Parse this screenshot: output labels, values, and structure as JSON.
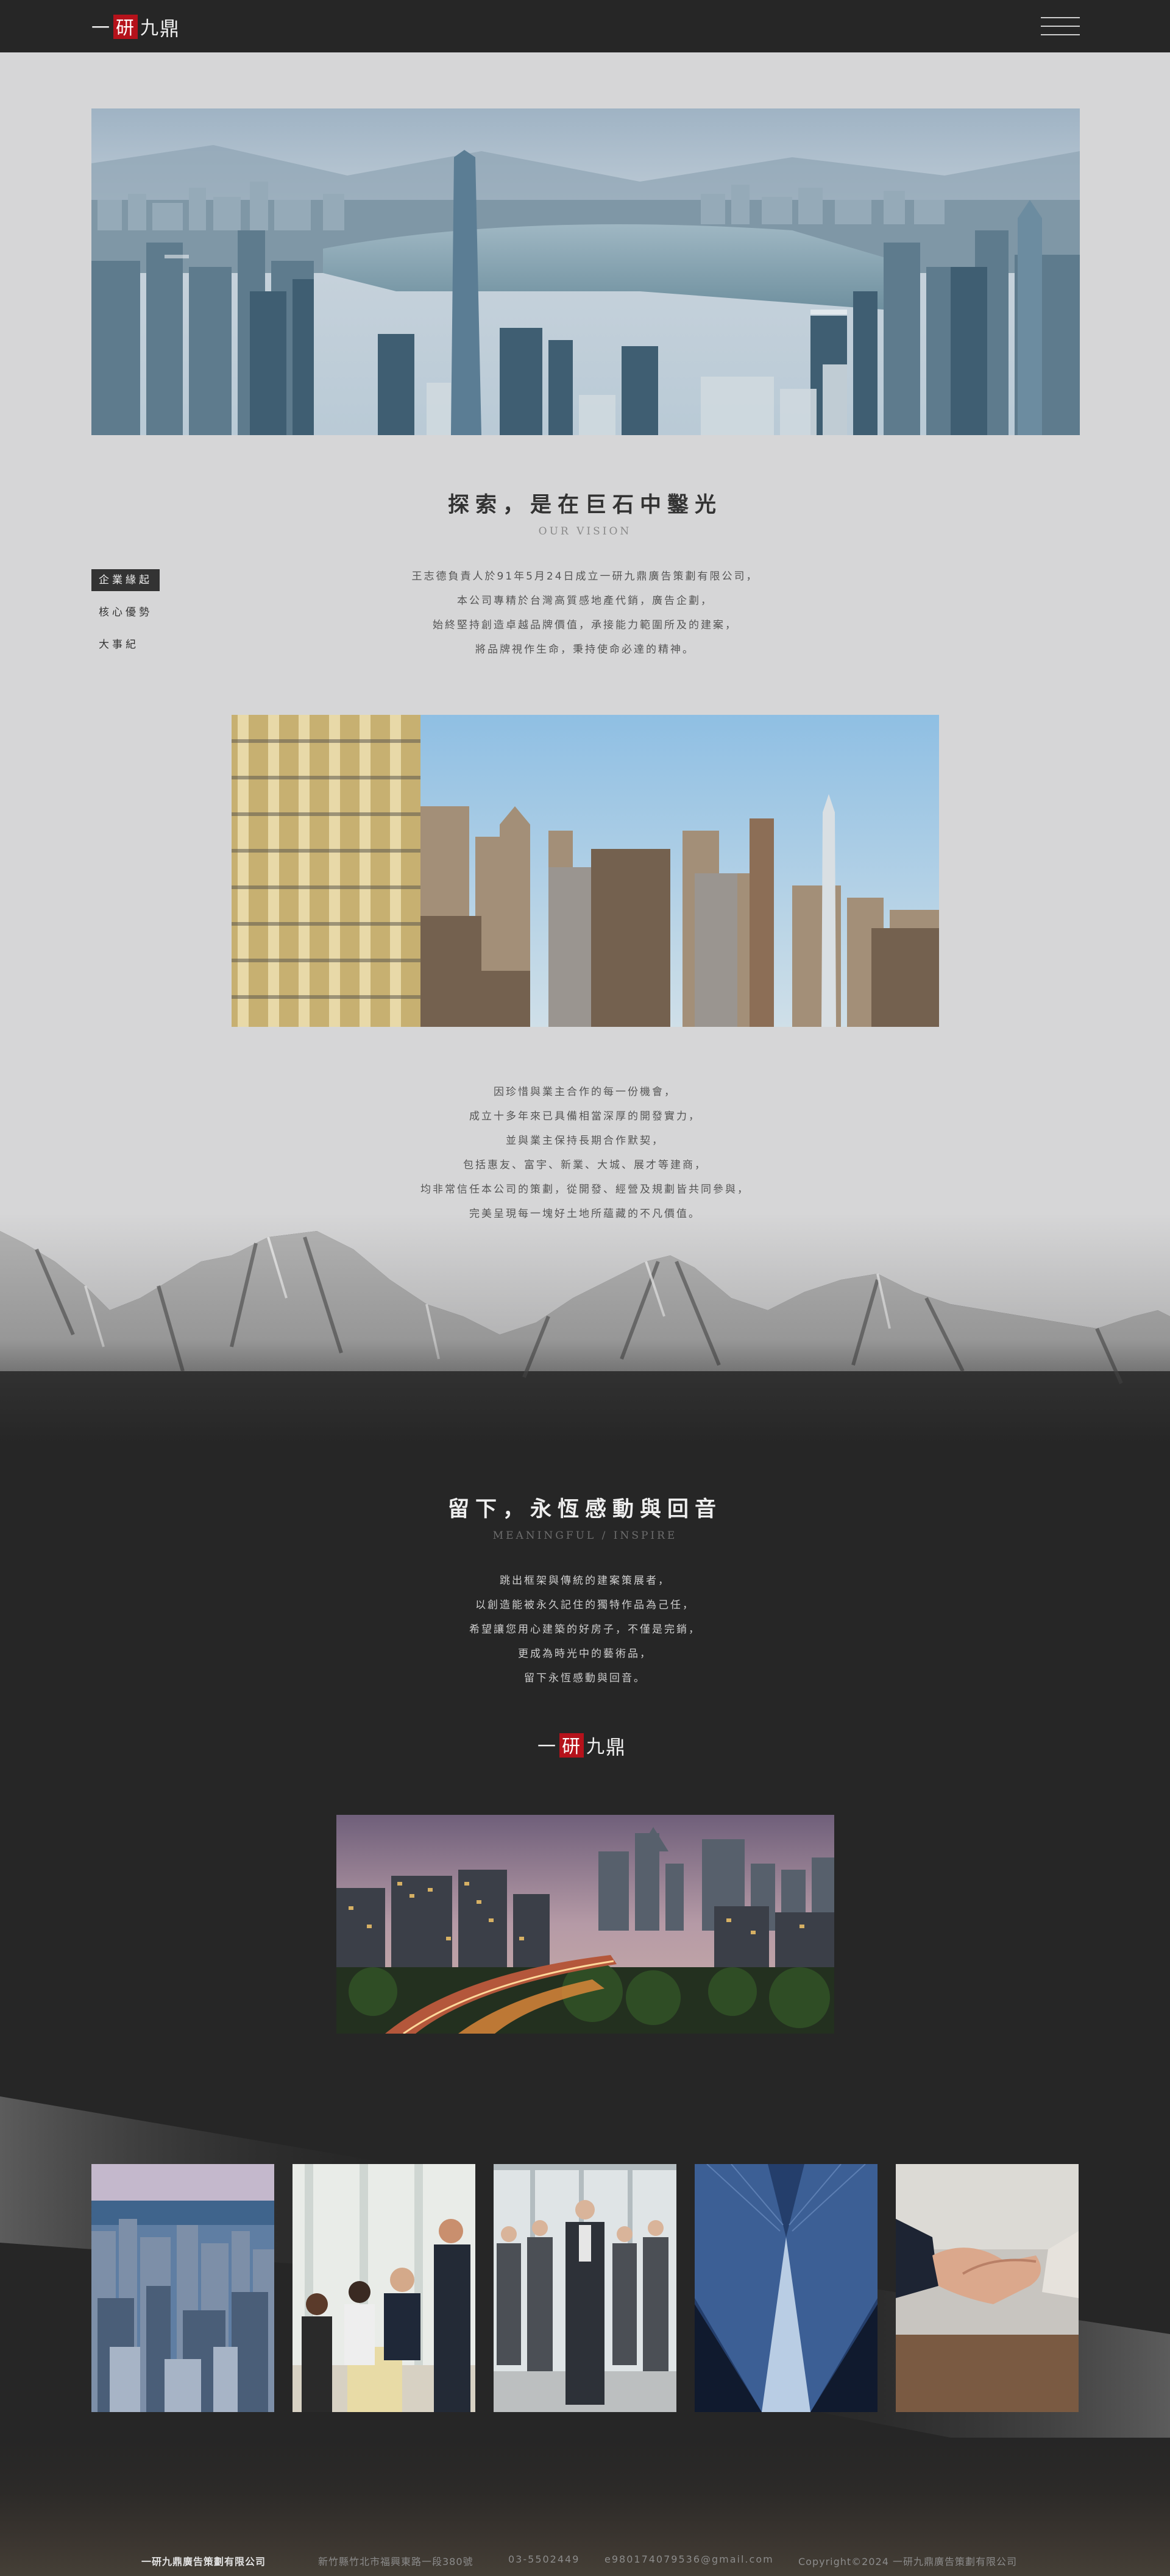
{
  "brand": {
    "logo_char_1": "一",
    "logo_char_2": "研",
    "logo_char_3": "九",
    "logo_char_4": "鼎"
  },
  "header": {
    "menu_icon": "hamburger-menu-icon"
  },
  "vision": {
    "title": "探索，是在巨石中鑿光",
    "subtitle": "OUR VISION",
    "paragraph": [
      "王志德負責人於91年5月24日成立一研九鼎廣告策劃有限公司，",
      "本公司專精於台灣高質感地產代銷，廣告企劃，",
      "始終堅持創造卓越品牌價值，承接能力範圍所及的建案，",
      "將品牌視作生命，秉持使命必達的精神。"
    ]
  },
  "side_tabs": [
    {
      "label": "企業緣起",
      "active": true
    },
    {
      "label": "核心優勢",
      "active": false
    },
    {
      "label": "大事紀",
      "active": false
    }
  ],
  "story": {
    "paragraph": [
      "因珍惜與業主合作的每一份機會，",
      "成立十多年來已具備相當深厚的開發實力，",
      "並與業主保持長期合作默契，",
      "包括惠友、富宇、新業、大城、展才等建商，",
      "均非常信任本公司的策劃，從開發、經營及規劃皆共同參與，",
      "完美呈現每一塊好土地所蘊藏的不凡價值。"
    ]
  },
  "remain": {
    "title": "留下，永恆感動與回音",
    "subtitle": "MEANINGFUL / INSPIRE",
    "paragraph": [
      "跳出框架與傳統的建案策展者，",
      "以創造能被永久記住的獨特作品為己任，",
      "希望讓您用心建築的好房子，不僅是完銷，",
      "更成為時光中的藝術品，",
      "留下永恆感動與回音。"
    ]
  },
  "footer": {
    "company": "一研九鼎廣告策劃有限公司",
    "address": "新竹縣竹北市福興東路一段380號",
    "phone": "03-5502449",
    "email": "e980174079536@gmail.com",
    "copyright": "Copyright©2024 一研九鼎廣告策劃有限公司"
  },
  "colors": {
    "page_bg": "#d6d6d7",
    "dark_bg": "#262626",
    "seal_red": "#b5121b",
    "active_tab_bg": "#333333"
  }
}
